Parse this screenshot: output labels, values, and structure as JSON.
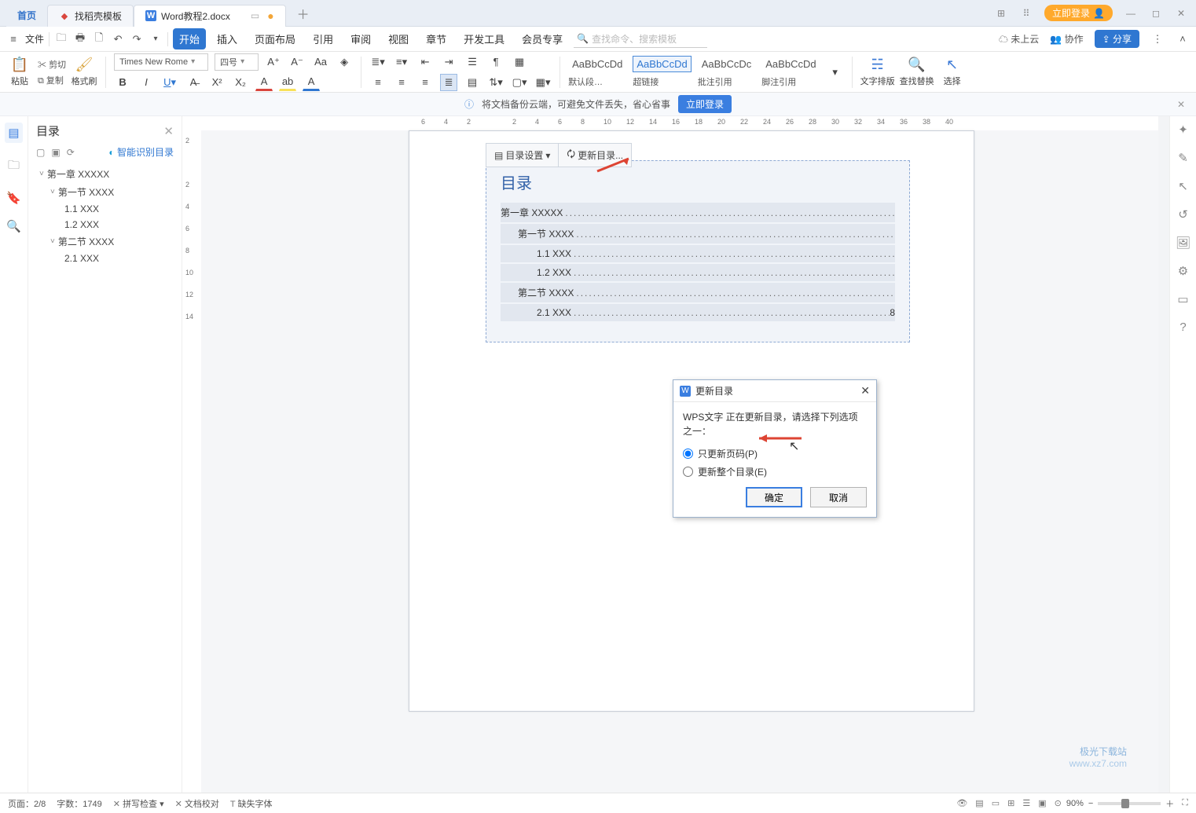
{
  "tabs": {
    "home": "首页",
    "template": "找稻壳模板",
    "doc": "Word教程2.docx"
  },
  "login_pill": "立即登录",
  "quick": {
    "file": "文件"
  },
  "menu": {
    "items": [
      "开始",
      "插入",
      "页面布局",
      "引用",
      "审阅",
      "视图",
      "章节",
      "开发工具",
      "会员专享"
    ],
    "active": 0,
    "search_placeholder": "查找命令、搜索模板",
    "notcloud": "未上云",
    "collab": "协作",
    "share": "分享"
  },
  "ribbon": {
    "paste": "粘贴",
    "cut": "剪切",
    "copy": "复制",
    "format": "格式刷",
    "font": "Times New Rome",
    "size": "四号",
    "style_samples": [
      "AaBbCcDd",
      "AaBbCcDd",
      "AaBbCcDc",
      "AaBbCcDd"
    ],
    "style_labels": [
      "默认段…",
      "超链接",
      "批注引用",
      "脚注引用"
    ],
    "textlayout": "文字排版",
    "findreplace": "查找替换",
    "select": "选择"
  },
  "banner": {
    "text": "将文档备份云端，可避免文件丢失，省心省事",
    "login": "立即登录"
  },
  "nav": {
    "title": "目录",
    "smart": "智能识别目录",
    "items": [
      {
        "lvl": 1,
        "exp": true,
        "label": "第一章  XXXXX"
      },
      {
        "lvl": 2,
        "exp": true,
        "label": "第一节  XXXX"
      },
      {
        "lvl": 3,
        "label": "1.1 XXX"
      },
      {
        "lvl": 3,
        "label": "1.2 XXX"
      },
      {
        "lvl": 2,
        "exp": true,
        "label": "第二节  XXXX"
      },
      {
        "lvl": 3,
        "label": "2.1 XXX"
      }
    ]
  },
  "tocbar": {
    "settings": "目录设置",
    "update": "更新目录..."
  },
  "toc": {
    "title": "目录",
    "lines": [
      {
        "lvl": 1,
        "label": "第一章  XXXXX",
        "page": ""
      },
      {
        "lvl": 2,
        "label": "第一节  XXXX",
        "page": ""
      },
      {
        "lvl": 3,
        "label": "1.1 XXX",
        "page": ""
      },
      {
        "lvl": 3,
        "label": "1.2 XXX",
        "page": ""
      },
      {
        "lvl": 2,
        "label": "第二节  XXXX",
        "page": ""
      },
      {
        "lvl": 3,
        "label": "2.1 XXX",
        "page": "8"
      }
    ]
  },
  "dialog": {
    "title": "更新目录",
    "desc": "WPS文字 正在更新目录，请选择下列选项之一：",
    "opt1": "只更新页码(P)",
    "opt2": "更新整个目录(E)",
    "ok": "确定",
    "cancel": "取消"
  },
  "ruler_h": [
    6,
    4,
    2,
    "",
    2,
    4,
    6,
    8,
    10,
    12,
    14,
    16,
    18,
    20,
    22,
    24,
    26,
    28,
    30,
    32,
    34,
    36,
    38,
    40
  ],
  "ruler_v": [
    2,
    "",
    2,
    4,
    6,
    8,
    10,
    12,
    14
  ],
  "status": {
    "page": "页面：2/8",
    "words": "字数：1749",
    "spell": "拼写检查",
    "proof": "文档校对",
    "missingfont": "缺失字体",
    "zoom": "90%"
  },
  "watermark": {
    "l1": "极光下载站",
    "l2": "www.xz7.com"
  }
}
